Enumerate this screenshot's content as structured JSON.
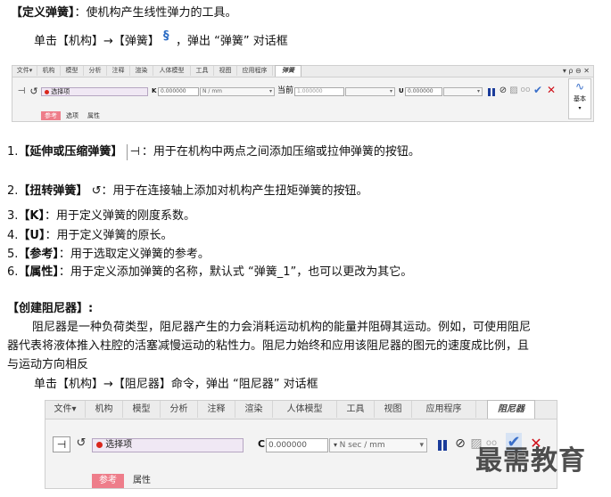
{
  "intro": {
    "term": "【定义弹簧】",
    "desc": "：使机构产生线性弹力的工具。",
    "steps_prefix": "单击【机构】→【弹簧】",
    "steps_suffix": "，弹出 “弹簧” 对话框"
  },
  "spring_ribbon": {
    "tabs": [
      "文件▾",
      "机构",
      "模型",
      "分析",
      "注释",
      "渲染",
      "人体模型",
      "工具",
      "视图",
      "应用程序",
      "弹簧"
    ],
    "select_label": "选择项",
    "k_value": "0.000000",
    "k_unit": "N / mm",
    "current_label": "当前",
    "current_value": "1.000000",
    "u_value": "0.000000",
    "basic_label": "基本",
    "subtabs": [
      "参考",
      "选项",
      "属性"
    ]
  },
  "items": [
    {
      "num": "1.",
      "term": "【延伸或压缩弹簧】",
      "desc": "：用于在机构中两点之间添加压缩或拉伸弹簧的按钮。"
    },
    {
      "num": "2.",
      "term": "【扭转弹簧】",
      "desc": "：用于在连接轴上添加对机构产生扭矩弹簧的按钮。"
    },
    {
      "num": "3.",
      "term": "【K】",
      "desc": "：用于定义弹簧的刚度系数。"
    },
    {
      "num": "4.",
      "term": "【U】",
      "desc": "：用于定义弹簧的原长。"
    },
    {
      "num": "5.",
      "term": "【参考】",
      "desc": "：用于选取定义弹簧的参考。"
    },
    {
      "num": "6.",
      "term": "【属性】",
      "desc": "：用于定义添加弹簧的名称，默认式 “弹簧_1”，也可以更改为其它。"
    }
  ],
  "damper": {
    "heading": "【创建阻尼器】",
    "heading_colon": ":",
    "para_line1": "阻尼器是一种负荷类型，阻尼器产生的力会消耗运动机构的能量并阻碍其运动。例如，可使用阻尼",
    "para_line2": "器代表将液体推入柱腔的活塞减慢运动的粘性力。阻尼力始终和应用该阻尼器的图元的速度成比例，且",
    "para_line3": "与运动方向相反",
    "steps": "单击【机构】→【阻尼器】命令，弹出 “阻尼器” 对话框"
  },
  "damper_ribbon": {
    "tabs": [
      "文件▾",
      "机构",
      "模型",
      "分析",
      "注释",
      "渲染",
      "人体模型",
      "工具",
      "视图",
      "应用程序",
      "阻尼器"
    ],
    "select_label": "选择项",
    "c_value": "0.000000",
    "c_unit": "N sec / mm",
    "subtabs": [
      "参考",
      "属性"
    ]
  },
  "watermark": "最需教育"
}
